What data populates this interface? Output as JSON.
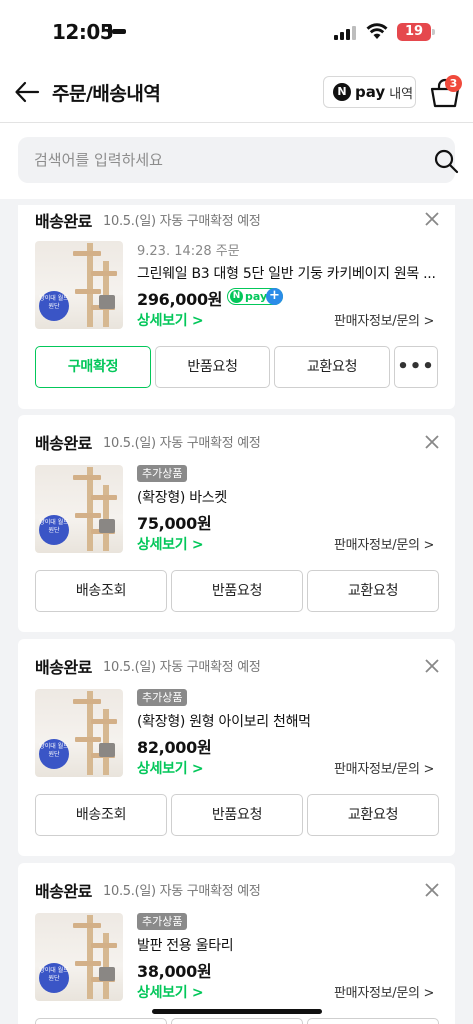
{
  "status_bar": {
    "time": "12:05",
    "battery": "19"
  },
  "header": {
    "title": "주문/배송내역",
    "npay_icon_letter": "N",
    "npay_word": "pay",
    "npay_label": "내역",
    "cart_count": "3"
  },
  "search": {
    "placeholder": "검색어를 입력하세요"
  },
  "orders": [
    {
      "status": "배송완료",
      "note": "10.5.(일) 자동 구매확정 예정",
      "order_date": "9.23. 14:28 주문",
      "product_name": "그린웨일 B3 대형 5단 일반 기둥 카키베이지 원목 ...",
      "price": "296,000원",
      "npay_plus": {
        "n": "N",
        "word": "pay",
        "plus": "+"
      },
      "detail": "상세보기 >",
      "seller": "판매자정보/문의 >",
      "buttons": [
        "구매확정",
        "반품요청",
        "교환요청"
      ],
      "more": "•••"
    },
    {
      "status": "배송완료",
      "note": "10.5.(일) 자동 구매확정 예정",
      "tag": "추가상품",
      "product_name": "(확장형) 바스켓",
      "price": "75,000원",
      "detail": "상세보기 >",
      "seller": "판매자정보/문의 >",
      "buttons": [
        "배송조회",
        "반품요청",
        "교환요청"
      ]
    },
    {
      "status": "배송완료",
      "note": "10.5.(일) 자동 구매확정 예정",
      "tag": "추가상품",
      "product_name": "(확장형) 원형 아이보리 천해먹",
      "price": "82,000원",
      "detail": "상세보기 >",
      "seller": "판매자정보/문의 >",
      "buttons": [
        "배송조회",
        "반품요청",
        "교환요청"
      ]
    },
    {
      "status": "배송완료",
      "note": "10.5.(일) 자동 구매확정 예정",
      "tag": "추가상품",
      "product_name": "발판 전용 울타리",
      "price": "38,000원",
      "detail": "상세보기 >",
      "seller": "판매자정보/문의 >"
    }
  ],
  "thumbnail_badge": "냥이대 월드 원단",
  "colors": {
    "accent_green": "#03c75a",
    "badge_red": "#f04a3c",
    "npay_blue": "#2b8ce8"
  }
}
